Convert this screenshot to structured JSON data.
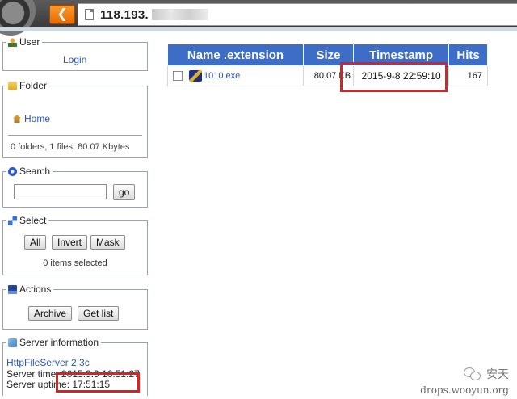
{
  "browser": {
    "back_icon": "chevron-left-icon",
    "url_visible": "118.193."
  },
  "sidebar": {
    "user": {
      "legend": "User",
      "login": "Login"
    },
    "folder": {
      "legend": "Folder",
      "home": "Home",
      "summary": "0 folders, 1 files, 80.07 Kbytes"
    },
    "search": {
      "legend": "Search",
      "go_label": "go",
      "input_value": ""
    },
    "select": {
      "legend": "Select",
      "all_label": "All",
      "invert_label": "Invert",
      "mask_label": "Mask",
      "status": "0 items selected"
    },
    "actions": {
      "legend": "Actions",
      "archive_label": "Archive",
      "getlist_label": "Get list"
    },
    "server": {
      "legend": "Server information",
      "software": "HttpFileServer 2.3c",
      "time_label": "Server time:",
      "time_value": "2015.9.9 16:51:27",
      "uptime_label": "Server uptime:",
      "uptime_value": "17:51:15"
    }
  },
  "table": {
    "headers": [
      "Name .extension",
      "Size",
      "Timestamp",
      "Hits"
    ],
    "rows": [
      {
        "name": "1010.exe",
        "size": "80.07 KB",
        "timestamp": "2015-9-8 22:59:10",
        "hits": "167"
      }
    ]
  },
  "watermark": {
    "brand": "安天",
    "site": "drops.wooyun.org"
  },
  "colors": {
    "header_blue": "#3d6dc7",
    "highlight_red": "#e02020",
    "link_blue": "#2a57b8",
    "back_orange": "#ff8c1a"
  }
}
